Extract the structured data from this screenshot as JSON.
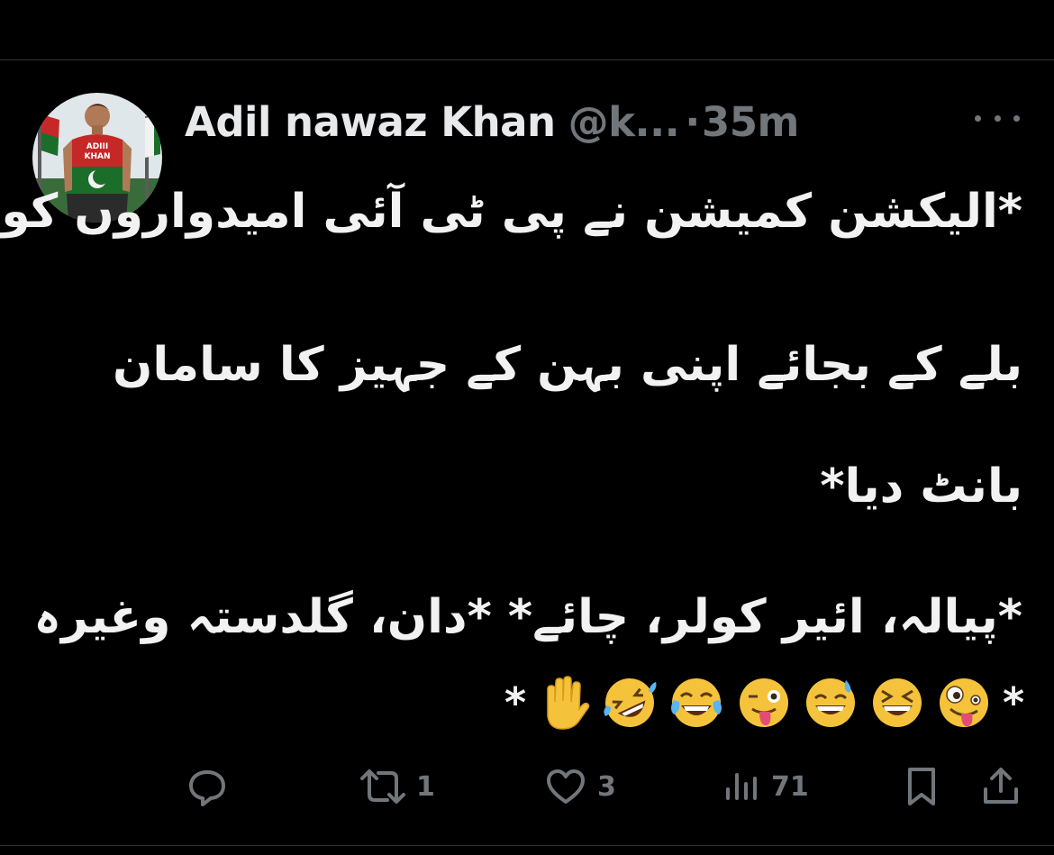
{
  "tweet": {
    "author": {
      "display_name": "Adil nawaz Khan",
      "handle": "@k...",
      "separator": "·",
      "time_ago": "35m",
      "avatar_shirt_text": [
        "ADIII",
        "KHAN"
      ]
    },
    "text_lines": [
      "*الیکشن کمیشن نے پی ٹی آئی امیدواروں کو",
      "بلے کے بجائے اپنی بہن کے جہیز کا سامان",
      "بانٹ دیا*",
      "*پیالہ، ائیر کولر، چائے* *دان، گلدستہ وغیرہ"
    ],
    "emoji_line": {
      "leading_asterisk": "*",
      "trailing_asterisk": "*",
      "emojis": [
        "zany-face",
        "grinning-squinting-face",
        "grinning-sweat-face",
        "winking-tongue-face",
        "tears-of-joy-face",
        "rolling-on-floor-laughing-face",
        "raised-hand"
      ]
    },
    "actions": {
      "reply": {
        "icon": "reply-icon",
        "count": ""
      },
      "retweet": {
        "icon": "retweet-icon",
        "count": "1"
      },
      "like": {
        "icon": "heart-icon",
        "count": "3"
      },
      "views": {
        "icon": "views-icon",
        "count": "71"
      },
      "bookmark": {
        "icon": "bookmark-icon"
      },
      "share": {
        "icon": "share-icon"
      }
    }
  },
  "colors": {
    "background": "#000000",
    "primary_text": "#e7e9ea",
    "secondary_text": "#71767b",
    "divider": "#2f3336",
    "avatar_shirt_red": "#c62828",
    "avatar_shirt_green": "#1b6e2a",
    "emoji_yellow": "#f5c33b"
  }
}
